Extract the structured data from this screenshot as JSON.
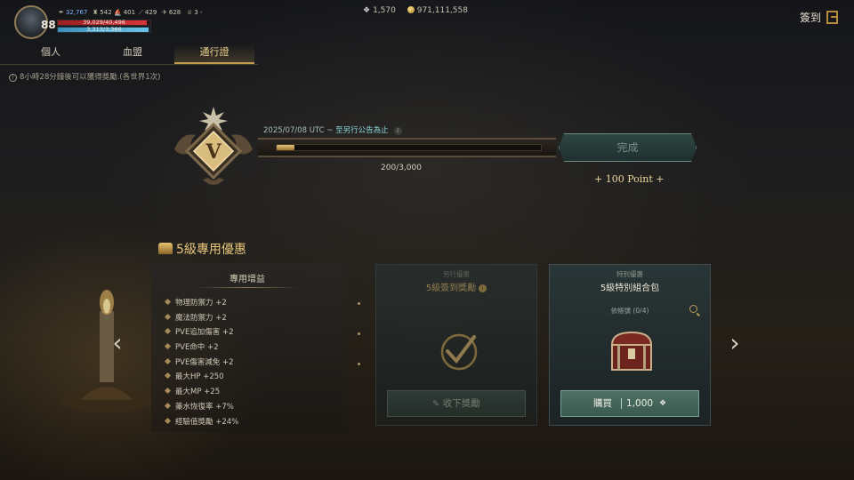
{
  "hud": {
    "level": "88",
    "power": "32,767",
    "stat_a": "542",
    "stat_b": "401",
    "stat_c": "429",
    "stat_d": "628",
    "stat_e": "3 -",
    "hp_text": "39,029/40,496",
    "hp_fraction": 0.96,
    "mp_text": "3,313/3,366",
    "mp_fraction": 0.98
  },
  "currency": {
    "gems": "1,570",
    "gold": "971,111,558"
  },
  "checkin_label": "簽到",
  "tabs": [
    {
      "label": "個人"
    },
    {
      "label": "血盟"
    },
    {
      "label": "通行證"
    }
  ],
  "notice": "8小時28分鐘後可以獲得獎勵.(各世界1次)",
  "pass": {
    "emblem_letter": "V",
    "period": "2025/07/08 UTC ~ ",
    "period_hint": "至另行公告為止",
    "progress_text": "200/3,000",
    "progress_fraction": 0.067,
    "complete_label": "完成",
    "points_label": "+ 100 Point +"
  },
  "section_title": "5級專用優惠",
  "buffs": {
    "title": "專用增益",
    "items": [
      "物理防禦力 +2",
      "魔法防禦力 +2",
      "PVE追加傷害 +2",
      "PVE命中 +2",
      "PVE傷害減免 +2",
      "最大HP +250",
      "最大MP +25",
      "藥水恢復率 +7%",
      "經驗值獎勵 +24%"
    ]
  },
  "card_checkin": {
    "category": "另行優惠",
    "name": "5級簽到獎勵",
    "claim_label": "收下獎勵"
  },
  "card_special": {
    "category": "特別優惠",
    "name": "5級特別組合包",
    "limit": "依帳號 (0/4)",
    "buy_label": "購買",
    "price": "1,000"
  },
  "colors": {
    "accent_gold": "#e7c57a",
    "teal_button": "#3a5a50",
    "hp": "#d6353a",
    "mp": "#6ac3e6"
  }
}
